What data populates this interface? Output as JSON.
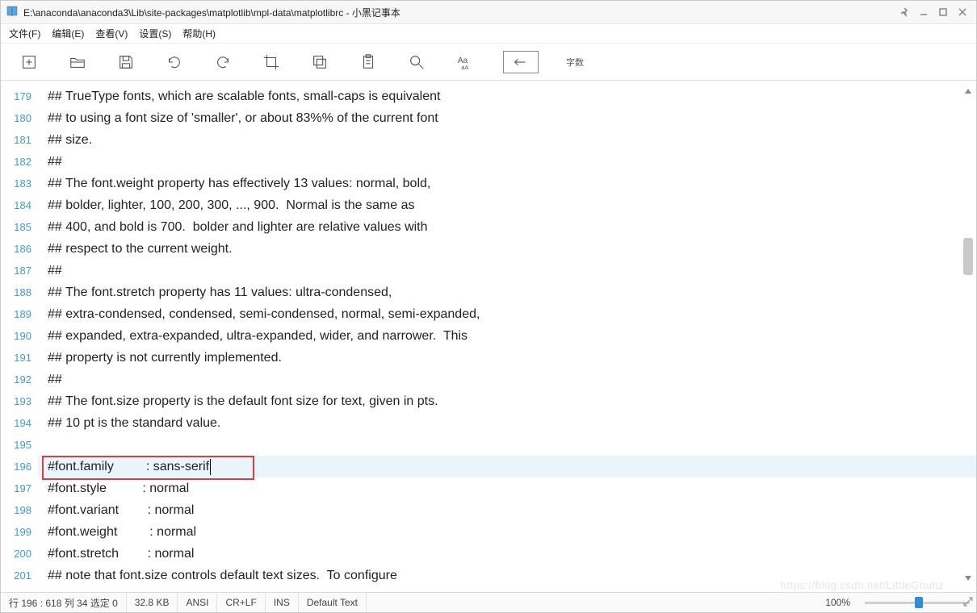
{
  "window": {
    "title": "E:\\anaconda\\anaconda3\\Lib\\site-packages\\matplotlib\\mpl-data\\matplotlibrc - 小黑记事本"
  },
  "menu": {
    "file": "文件(F)",
    "edit": "编辑(E)",
    "view": "查看(V)",
    "settings": "设置(S)",
    "help": "帮助(H)"
  },
  "toolbar": {
    "word_count_label": "字数"
  },
  "lines": [
    {
      "n": 179,
      "t": "## TrueType fonts, which are scalable fonts, small-caps is equivalent"
    },
    {
      "n": 180,
      "t": "## to using a font size of 'smaller', or about 83%% of the current font"
    },
    {
      "n": 181,
      "t": "## size."
    },
    {
      "n": 182,
      "t": "##"
    },
    {
      "n": 183,
      "t": "## The font.weight property has effectively 13 values: normal, bold,"
    },
    {
      "n": 184,
      "t": "## bolder, lighter, 100, 200, 300, ..., 900.  Normal is the same as"
    },
    {
      "n": 185,
      "t": "## 400, and bold is 700.  bolder and lighter are relative values with"
    },
    {
      "n": 186,
      "t": "## respect to the current weight."
    },
    {
      "n": 187,
      "t": "##"
    },
    {
      "n": 188,
      "t": "## The font.stretch property has 11 values: ultra-condensed,"
    },
    {
      "n": 189,
      "t": "## extra-condensed, condensed, semi-condensed, normal, semi-expanded,"
    },
    {
      "n": 190,
      "t": "## expanded, extra-expanded, ultra-expanded, wider, and narrower.  This"
    },
    {
      "n": 191,
      "t": "## property is not currently implemented."
    },
    {
      "n": 192,
      "t": "##"
    },
    {
      "n": 193,
      "t": "## The font.size property is the default font size for text, given in pts."
    },
    {
      "n": 194,
      "t": "## 10 pt is the standard value."
    },
    {
      "n": 195,
      "t": ""
    },
    {
      "n": 196,
      "t": "#font.family         : sans-serif"
    },
    {
      "n": 197,
      "t": "#font.style          : normal"
    },
    {
      "n": 198,
      "t": "#font.variant        : normal"
    },
    {
      "n": 199,
      "t": "#font.weight         : normal"
    },
    {
      "n": 200,
      "t": "#font.stretch        : normal"
    },
    {
      "n": 201,
      "t": "## note that font.size controls default text sizes.  To configure"
    }
  ],
  "highlighted_line": 196,
  "status": {
    "pos": "行 196 : 618   列 34   选定 0",
    "size": "32.8 KB",
    "encoding": "ANSI",
    "eol": "CR+LF",
    "mode": "INS",
    "syntax": "Default Text",
    "zoom": "100%"
  }
}
